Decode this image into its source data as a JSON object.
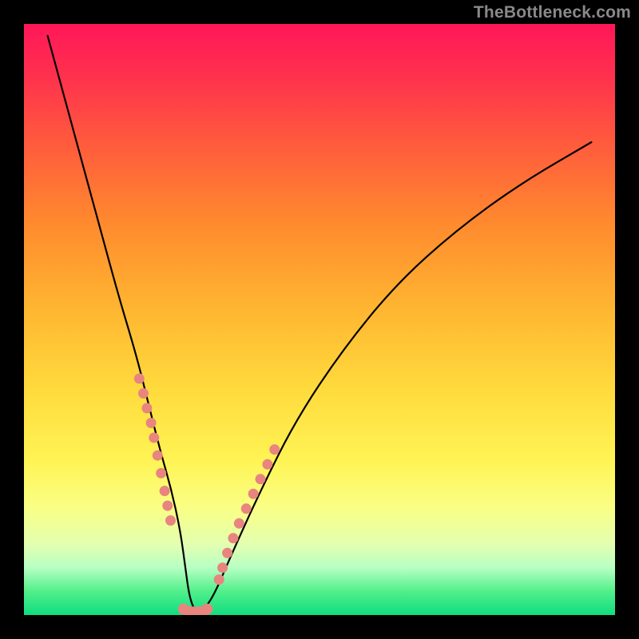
{
  "watermark": "TheBottleneck.com",
  "chart_data": {
    "type": "line",
    "title": "",
    "xlabel": "",
    "ylabel": "",
    "x_range": [
      0,
      100
    ],
    "y_range": [
      0,
      100
    ],
    "series": [
      {
        "name": "bottleneck-curve",
        "x": [
          4,
          7,
          10,
          13,
          16,
          19,
          21,
          23,
          25,
          26.5,
          27.3,
          28,
          29,
          30,
          32,
          35,
          40,
          46,
          54,
          63,
          73,
          84,
          96
        ],
        "values": [
          98,
          87,
          76,
          65,
          54,
          44,
          36,
          28,
          21,
          14,
          8,
          3,
          0.5,
          0.5,
          3,
          10,
          21,
          33,
          45,
          56,
          65,
          73,
          80
        ]
      }
    ],
    "markers": {
      "name": "highlighted-points",
      "color": "#e8857f",
      "left_cluster": {
        "x": [
          19.5,
          20.2,
          20.8,
          21.5,
          22.0,
          22.6,
          23.2,
          23.8,
          24.3,
          24.8
        ],
        "y": [
          40,
          37.5,
          35,
          32.5,
          30,
          27,
          24,
          21,
          18.5,
          16
        ]
      },
      "bottom_cluster": {
        "x": [
          27.0,
          27.8,
          28.6,
          29.4,
          30.2,
          31.0
        ],
        "y": [
          1.0,
          0.6,
          0.5,
          0.5,
          0.6,
          1.0
        ]
      },
      "right_cluster": {
        "x": [
          33.0,
          33.6,
          34.4,
          35.4,
          36.4,
          37.6,
          38.8,
          40.0,
          41.2,
          42.4
        ],
        "y": [
          6,
          8,
          10.5,
          13,
          15.5,
          18,
          20.5,
          23,
          25.5,
          28
        ]
      }
    },
    "gradient_stops": [
      {
        "pos": 0.0,
        "color": "#ff1758"
      },
      {
        "pos": 0.08,
        "color": "#ff2e4f"
      },
      {
        "pos": 0.2,
        "color": "#ff5a3d"
      },
      {
        "pos": 0.34,
        "color": "#ff8b2e"
      },
      {
        "pos": 0.48,
        "color": "#ffb531"
      },
      {
        "pos": 0.62,
        "color": "#ffdb3d"
      },
      {
        "pos": 0.74,
        "color": "#fff455"
      },
      {
        "pos": 0.82,
        "color": "#f9ff86"
      },
      {
        "pos": 0.88,
        "color": "#e3ffb0"
      },
      {
        "pos": 0.92,
        "color": "#b7ffc3"
      },
      {
        "pos": 0.96,
        "color": "#51ef8a"
      },
      {
        "pos": 1.0,
        "color": "#10dd7f"
      }
    ]
  }
}
